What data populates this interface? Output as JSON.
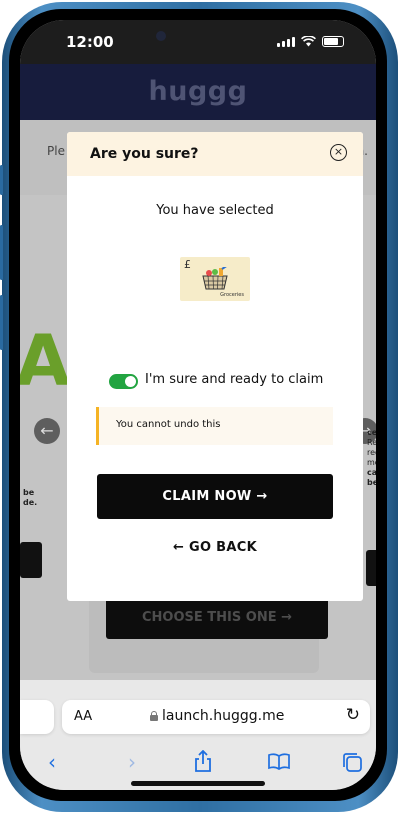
{
  "status": {
    "time": "12:00"
  },
  "site": {
    "logo": "huggg"
  },
  "background": {
    "band_text_left": "Ple",
    "band_text_right": "m.",
    "left_snippet_1": "be",
    "left_snippet_2": "de.",
    "right_snippet_1": "ce",
    "right_snippet_2": "Rec",
    "right_snippet_3": "red",
    "right_snippet_4": "mo",
    "right_snippet_5": "car",
    "right_snippet_6": "bee",
    "choose_label": "CHOOSE THIS ONE →"
  },
  "modal": {
    "title": "Are you sure?",
    "close_symbol": "×",
    "selected_text": "You have selected",
    "product": {
      "currency": "£",
      "caption": "Groceries"
    },
    "toggle_on": true,
    "confirm_label": "I'm sure and ready to claim",
    "warning": "You cannot undo this",
    "claim_label": "CLAIM NOW →",
    "goback_label": "← GO BACK"
  },
  "safari": {
    "aa_label": "AA",
    "url": "launch.huggg.me"
  },
  "colors": {
    "header_bg": "#171c3d",
    "modal_header_bg": "#fdf3e1",
    "toggle_green": "#22a441",
    "warning_accent": "#f5b324",
    "safari_blue": "#1f6fe0"
  }
}
